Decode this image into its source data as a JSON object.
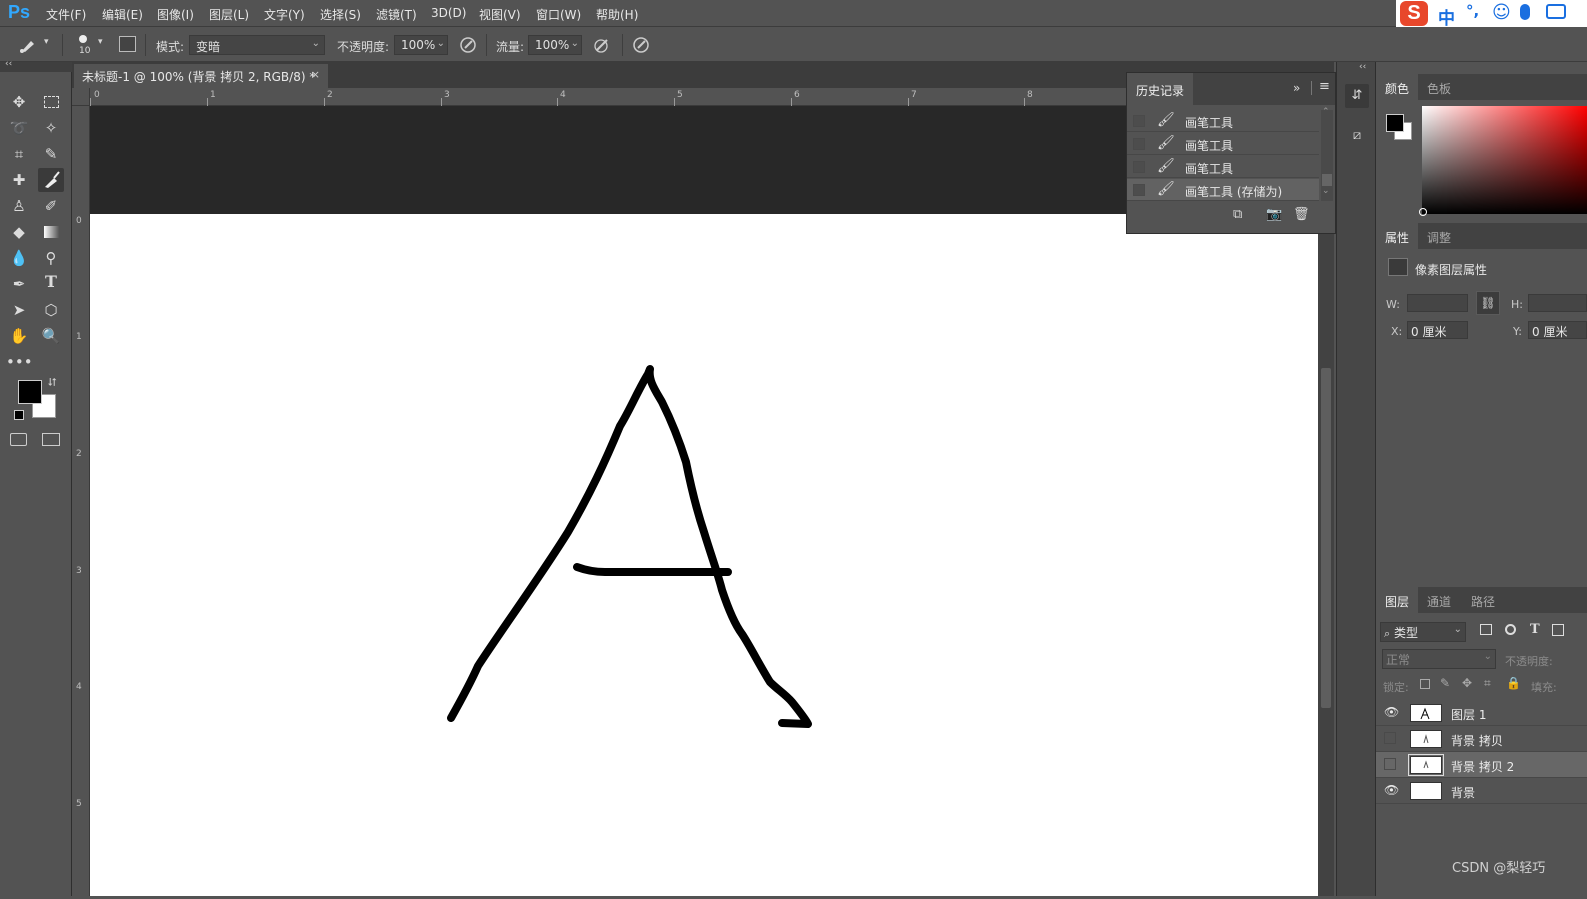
{
  "menu": {
    "logo": "Ps",
    "items": [
      "文件(F)",
      "编辑(E)",
      "图像(I)",
      "图层(L)",
      "文字(Y)",
      "选择(S)",
      "滤镜(T)",
      "3D(D)",
      "视图(V)",
      "窗口(W)",
      "帮助(H)"
    ]
  },
  "ime": {
    "logo": "S",
    "mode": "中",
    "punct": "°,",
    "face": "☺",
    "mic": "🎤",
    "keyboard": "⌨"
  },
  "options": {
    "brush_size": "10",
    "mode_label": "模式:",
    "mode_value": "变暗",
    "opacity_label": "不透明度:",
    "opacity_value": "100%",
    "flow_label": "流量:",
    "flow_value": "100%"
  },
  "document": {
    "tab_title": "未标题-1 @ 100% (背景 拷贝 2, RGB/8) *",
    "close": "×"
  },
  "rulers": {
    "h_ticks": [
      "0",
      "1",
      "2",
      "3",
      "4",
      "5",
      "6",
      "7",
      "8"
    ],
    "v_ticks": [
      "0",
      "1",
      "2",
      "3",
      "4",
      "5"
    ]
  },
  "history": {
    "title": "历史记录",
    "items": [
      {
        "label": "画笔工具",
        "selected": false
      },
      {
        "label": "画笔工具",
        "selected": false
      },
      {
        "label": "画笔工具",
        "selected": false
      },
      {
        "label": "画笔工具 (存储为)",
        "selected": true
      }
    ]
  },
  "color_panel": {
    "tabs": [
      "颜色",
      "色板"
    ],
    "foreground": "#000000",
    "background": "#ffffff",
    "hue": "#ff0000"
  },
  "properties": {
    "tabs": [
      "属性",
      "调整"
    ],
    "title": "像素图层属性",
    "w_label": "W:",
    "w_value": "",
    "h_label": "H:",
    "h_value": "",
    "x_label": "X:",
    "x_value": "0 厘米",
    "y_label": "Y:",
    "y_value": "0 厘米"
  },
  "layers_panel": {
    "tabs": [
      "图层",
      "通道",
      "路径"
    ],
    "filter": "类型",
    "blend_mode": "正常",
    "opacity_label": "不透明度:",
    "lock_label": "锁定:",
    "fill_label": "填充:",
    "layers": [
      {
        "name": "图层 1",
        "visible": true,
        "selected": false
      },
      {
        "name": "背景 拷贝",
        "visible": false,
        "selected": false
      },
      {
        "name": "背景 拷贝 2",
        "visible": false,
        "selected": true
      },
      {
        "name": "背景",
        "visible": true,
        "selected": false
      }
    ]
  },
  "watermark": "CSDN @梨轻巧"
}
